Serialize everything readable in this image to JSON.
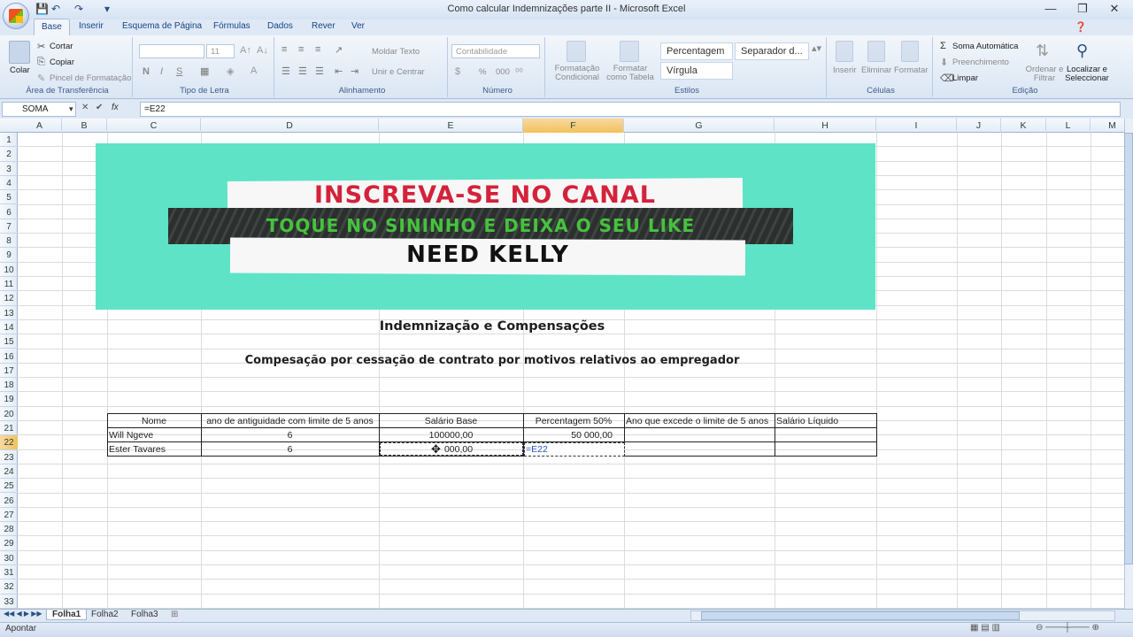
{
  "window": {
    "title": "Como calcular Indemnizações parte II - Microsoft Excel"
  },
  "tabs": [
    "Base",
    "Inserir",
    "Esquema de Página",
    "Fórmulas",
    "Dados",
    "Rever",
    "Ver"
  ],
  "ribbon": {
    "clipboard": {
      "paste": "Colar",
      "cut": "Cortar",
      "copy": "Copiar",
      "format_painter": "Pincel de Formatação",
      "label": "Área de Transferência"
    },
    "font": {
      "size": "11",
      "bold": "N",
      "italic": "I",
      "underline": "S",
      "label": "Tipo de Letra"
    },
    "alignment": {
      "wrap": "Moldar Texto",
      "merge": "Unir e Centrar",
      "label": "Alinhamento"
    },
    "number": {
      "format": "Contabilidade",
      "percent": "%",
      "thousands": "000",
      "label": "Número"
    },
    "styles": {
      "conditional": "Formatação Condicional",
      "as_table": "Formatar como Tabela",
      "style1": "Percentagem",
      "style2": "Separador d...",
      "style3": "Vírgula",
      "label": "Estilos"
    },
    "cells": {
      "insert": "Inserir",
      "delete": "Eliminar",
      "format": "Formatar",
      "label": "Células"
    },
    "editing": {
      "autosum": "Soma Automática",
      "fill": "Preenchimento",
      "clear": "Limpar",
      "sort": "Ordenar e Filtrar",
      "find": "Localizar e Seleccionar",
      "label": "Edição"
    }
  },
  "formula_bar": {
    "name_box": "SOMA",
    "fx": "fx",
    "formula": "=E22"
  },
  "columns": [
    "A",
    "B",
    "C",
    "D",
    "E",
    "F",
    "G",
    "H",
    "I",
    "J",
    "K",
    "L",
    "M"
  ],
  "rows": [
    "1",
    "2",
    "3",
    "4",
    "5",
    "6",
    "7",
    "8",
    "9",
    "10",
    "11",
    "12",
    "13",
    "14",
    "15",
    "16",
    "17",
    "18",
    "19",
    "20",
    "21",
    "22",
    "23",
    "24",
    "25",
    "26",
    "27",
    "28",
    "29",
    "30",
    "31",
    "32",
    "33"
  ],
  "banner": {
    "line1": "INSCREVA-SE NO CANAL",
    "line2": "TOQUE NO SININHO E DEIXA O SEU LIKE",
    "line3": "NEED KELLY"
  },
  "sheet": {
    "title": "Indemnização e Compensações",
    "subtitle": "Compesação por cessação de contrato por motivos relativos ao empregador",
    "headers": [
      "Nome",
      "ano de antiguidade com limite de 5 anos",
      "Salário Base",
      "Percentagem 50%",
      "Ano que excede o limite de 5 anos",
      "Salário Líquido"
    ],
    "rows": [
      {
        "nome": "Will Ngeve",
        "anos": "6",
        "salario": "100000,00",
        "percentagem": "50 000,00"
      },
      {
        "nome": "Ester Tavares",
        "anos": "6",
        "salario": "000,00",
        "percentagem": "=E22"
      }
    ]
  },
  "sheet_tabs": [
    "Folha1",
    "Folha2",
    "Folha3"
  ],
  "status": {
    "mode": "Apontar"
  },
  "colors": {
    "banner_bg": "#5ee3c6",
    "line1": "#d4223b",
    "line2": "#46c23e",
    "selected_header": "#f1c15f"
  }
}
